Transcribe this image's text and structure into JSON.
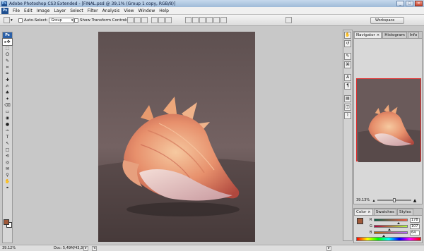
{
  "window": {
    "title": "Adobe Photoshop CS3 Extended - [FINAL.psd @ 39,1% (Group 1 copy, RGB/8)]",
    "app_badge": "Ps",
    "buttons": {
      "minimize": "_",
      "maximize": "□",
      "close": "✕"
    }
  },
  "menu": {
    "badge": "Ps",
    "items": [
      "File",
      "Edit",
      "Image",
      "Layer",
      "Select",
      "Filter",
      "Analysis",
      "View",
      "Window",
      "Help"
    ]
  },
  "options": {
    "auto_select_label": "Auto-Select:",
    "auto_select_value": "Group",
    "show_transform_label": "Show Transform Controls",
    "workspace_label": "Workspace"
  },
  "toolbox": {
    "badge": "Ps",
    "tools": [
      "move-tool",
      "marquee-tool",
      "lasso-tool",
      "quick-select-tool",
      "crop-tool",
      "eyedropper-tool",
      "healing-brush-tool",
      "brush-tool",
      "clone-stamp-tool",
      "history-brush-tool",
      "eraser-tool",
      "gradient-tool",
      "blur-tool",
      "dodge-tool",
      "pen-tool",
      "type-tool",
      "path-select-tool",
      "shape-tool",
      "3d-rotate-tool",
      "3d-orbit-tool",
      "notes-tool",
      "eyedropper-2-tool",
      "hand-tool",
      "zoom-tool"
    ],
    "glyphs": [
      "▸✥",
      "⬚",
      "ⵔ",
      "✎",
      "⌗",
      "✒",
      "✚",
      "✍",
      "♣",
      "✦",
      "⌫",
      "▭",
      "◉",
      "●",
      "✑",
      "T",
      "↖",
      "□",
      "⟲",
      "◎",
      "✉",
      "⚲",
      "✋",
      "⚭"
    ],
    "foreground_color": "#a05a3a",
    "background_color": "#ffffff"
  },
  "navigator": {
    "tabs": [
      "Navigator ×",
      "Histogram",
      "Info"
    ],
    "zoom": "39.13%"
  },
  "color_panel": {
    "tabs": [
      "Color ×",
      "Swatches",
      "Styles"
    ],
    "channels": [
      {
        "label": "R",
        "value": "178"
      },
      {
        "label": "G",
        "value": "107"
      },
      {
        "label": "B",
        "value": "64"
      }
    ]
  },
  "status": {
    "zoom": "39.12%",
    "doc": "Doc: 5,49M/43,3M"
  },
  "dock": {
    "icons": [
      "hand-icon",
      "history-icon",
      "brushes-icon",
      "clone-source-icon",
      "character-icon",
      "paragraph-icon",
      "layers-icon",
      "channels-icon",
      "paths-icon"
    ]
  }
}
